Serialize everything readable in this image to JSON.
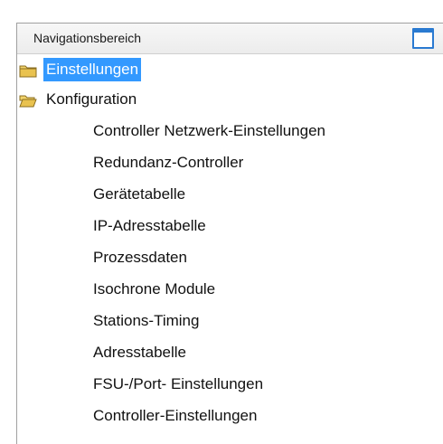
{
  "header": {
    "title": "Navigationsbereich",
    "window_icon": "window-icon"
  },
  "tree": {
    "roots": [
      {
        "label": "Einstellungen",
        "icon": "folder-closed-icon",
        "selected": true
      },
      {
        "label": "Konfiguration",
        "icon": "folder-open-icon",
        "selected": false
      }
    ],
    "children": [
      "Controller Netzwerk-Einstellungen",
      "Redundanz-Controller",
      "Gerätetabelle",
      "IP-Adresstabelle",
      "Prozessdaten",
      "Isochrone Module",
      "Stations-Timing",
      "Adresstabelle",
      "FSU-/Port- Einstellungen",
      "Controller-Einstellungen"
    ]
  },
  "colors": {
    "selection": "#3399ff",
    "accent": "#2a7ad1",
    "folder": "#f2d36b"
  }
}
